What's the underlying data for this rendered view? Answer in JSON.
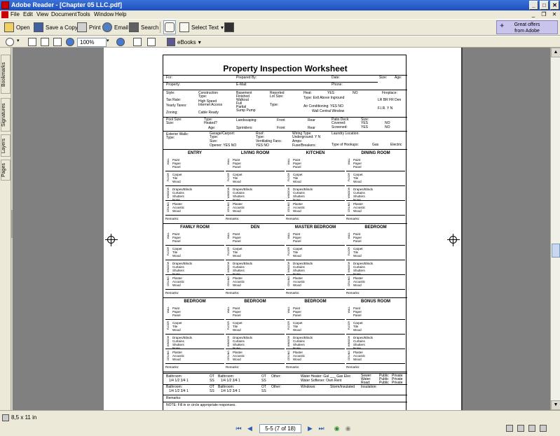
{
  "window": {
    "title": "Adobe Reader - [Chapter 05 LLC.pdf]",
    "minimize": "_",
    "maximize": "□",
    "close": "✕"
  },
  "menu": {
    "items": [
      "File",
      "Edit",
      "View",
      "Document",
      "Tools",
      "Window",
      "Help"
    ]
  },
  "toolbar": {
    "open": "Open",
    "save_copy": "Save a Copy",
    "print": "Print",
    "email": "Email",
    "search": "Search",
    "select_text": "Select Text",
    "offers_line1": "Great offers",
    "offers_line2": "from Adobe",
    "zoom": "100%",
    "ebooks": "eBooks"
  },
  "nav_tabs": [
    "Bookmarks",
    "Signatures",
    "Layers",
    "Pages"
  ],
  "status": {
    "page_size": "8,5 x 11 in",
    "page_indicator": "5-5  (7 of 18)"
  },
  "worksheet": {
    "title": "Property Inspection Worksheet",
    "row1": {
      "for": "For:",
      "prepared_by": "Prepared By:",
      "date": "Date:",
      "size": "Size:",
      "age": "Age:"
    },
    "row2": {
      "property": "Property:",
      "email": "E-Mail:",
      "phone": "Phone:"
    },
    "row3": {
      "style": "Style:",
      "construction": "Construction",
      "type": "Type:",
      "basement": "Basement",
      "finished": "Finished",
      "walkout": "Walkout",
      "full": "Full",
      "partial": "Partial",
      "sump": "Sump Pump",
      "reported": "Reported",
      "lot_size": "Lot Size:",
      "type2": "Type:",
      "heat": "Heat:",
      "yes": "YES",
      "no": "NO",
      "fireplace": "Fireplace:",
      "fp_rooms": "LR BR FR Den"
    },
    "row3b": {
      "tax_rate": "Tax Rate:",
      "high_speed": "High Speed",
      "internet_access": "Internet Access",
      "yearly_taxes": "Yearly Taxes:",
      "zoning": "Zoning:",
      "cable_ready": "Cable Ready",
      "type_line": "Type:   Extl     Above     Inground",
      "air_cond": "Air Conditioning:  YES        NO",
      "wall_central": "Wall         Central         Window",
      "fir": "F.I.R.   Y    N"
    },
    "row4": {
      "pool_size": "Pool Size:",
      "size": "Size:",
      "pool_type": "Type:",
      "heated": "Heated?",
      "age": "Age:",
      "landscaping": "Landscaping:",
      "sprinklers": "Sprinklers:",
      "front": "Front",
      "rear": "Rear",
      "patio": "Patio Deck:",
      "covered": "Covered:",
      "screened": "Screened:",
      "size2": "Size:"
    },
    "row5": {
      "exterior": "Exterior Walls:",
      "type": "Type:",
      "garage": "Garage/Carport:",
      "type2": "Type:",
      "size": "Size:",
      "opener": "Opener:  YES     NO",
      "roof": "Roof:",
      "type3": "Type:",
      "vent": "Ventilating Fans:",
      "yes_no": "YES     NO",
      "wiring": "Wiring Type:",
      "underground": "Underground:  Y    N",
      "amps": "Amps:",
      "fuse": "Fuse/Breakers:",
      "laundry": "Laundry Location:",
      "hookups": "Type of Hookups:",
      "gas": "Gas",
      "electric": "Electric"
    },
    "sides": {
      "wall": "WALL",
      "floor": "FLOOR",
      "window": "WINDOW",
      "ceiling": "CEILING"
    },
    "opts": {
      "wall": [
        "Paint",
        "Paper",
        "Panel"
      ],
      "floor": [
        "Carpet",
        "Tile",
        "Wood"
      ],
      "window": [
        "Drapes/Blinds",
        "Curtains",
        "Shutters",
        "None"
      ],
      "ceiling": [
        "Plaster",
        "Acoustic",
        "Wood"
      ]
    },
    "remarks": "Remarks:",
    "rooms_row1": [
      "ENTRY",
      "LIVING ROOM",
      "KITCHEN",
      "DINING ROOM"
    ],
    "rooms_row2": [
      "FAMILY ROOM",
      "DEN",
      "MASTER BEDROOM",
      "BEDROOM"
    ],
    "rooms_row3": [
      "BEDROOM",
      "BEDROOM",
      "BEDROOM",
      "BONUS ROOM"
    ],
    "bath": {
      "bathroom": "Bathroom:",
      "counts": "1/4   1/2   3/4   1",
      "ot": "OT",
      "ss": "SS",
      "other": "Other:",
      "water_heater": "Water Heater:  Gal ___  Gas  Elec",
      "water_softener": "Water Softener:  Own   Rent",
      "sewer": "Sewer:",
      "water": "Water:",
      "road": "Road:",
      "public": "Public",
      "private": "Private",
      "windows": "Windows:",
      "storm": "Storm/Insulated",
      "insulation": "Insulation:"
    },
    "footer_remarks": "Remarks:",
    "note": "NOTE: Fill in or circle appropriate responses."
  }
}
